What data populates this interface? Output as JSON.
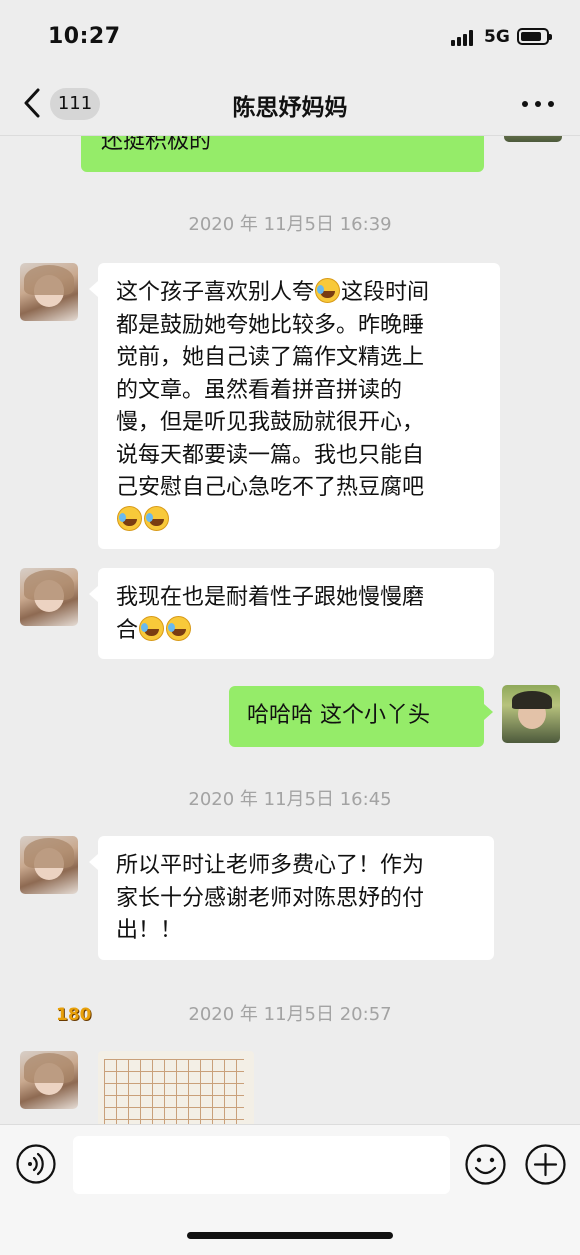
{
  "status": {
    "time": "10:27",
    "network": "5G",
    "battery_level": 0.85
  },
  "nav": {
    "unread_count": "111",
    "title": "陈思妤妈妈"
  },
  "messages": {
    "prev_tail": "还挺积极的",
    "ts1": "2020 年 11月5日 16:39",
    "m1_lines": [
      "这个孩子喜欢别人夸",
      "这段时间",
      "都是鼓励她夸她比较多。昨晚睡",
      "觉前，她自己读了篇作文精选上",
      "的文章。虽然看着拼音拼读的",
      "慢，但是听见我鼓励就很开心，",
      "说每天都要读一篇。我也只能自",
      "己安慰自己心急吃不了热豆腐吧"
    ],
    "m2_lines": [
      "我现在也是耐着性子跟她慢慢磨",
      "合"
    ],
    "m3": "哈哈哈 这个小丫头",
    "ts2": "2020 年 11月5日 16:45",
    "m4_lines": [
      "所以平时让老师多费心了！作为",
      "家长十分感谢老师对陈思妤的付",
      "出！！"
    ],
    "ts3": "2020 年 11月5日 20:57",
    "watermark": "180"
  },
  "input": {
    "value": ""
  },
  "icons": {
    "back": "chevron-left-icon",
    "more": "more-dots-icon",
    "voice": "voice-icon",
    "emoji": "emoji-icon",
    "plus": "plus-icon",
    "cry_laugh": "cry-laugh-emoji"
  },
  "colors": {
    "bubble_out": "#95ec69",
    "bubble_in": "#ffffff",
    "background": "#ededed",
    "timestamp": "#a3a3a3"
  }
}
